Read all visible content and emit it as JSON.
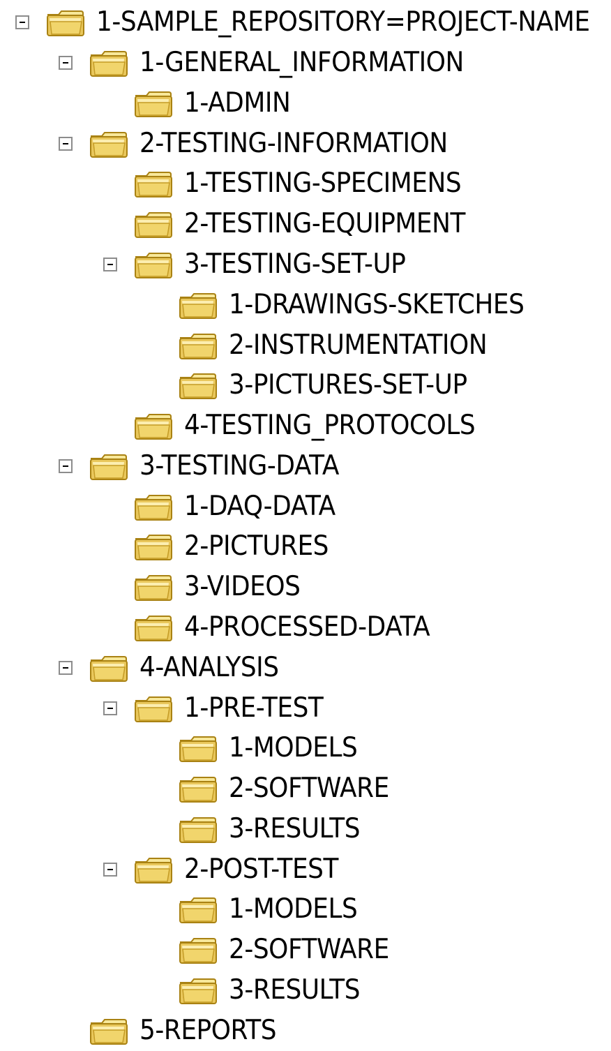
{
  "tree": {
    "root": {
      "label": "1-SAMPLE_REPOSITORY=PROJECT-NAME",
      "expanded": true,
      "icon": "folder-icon"
    },
    "items": [
      {
        "label": "1-GENERAL_INFORMATION",
        "expanded": true,
        "icon": "folder-icon"
      },
      {
        "label": "1-ADMIN",
        "icon": "folder-icon"
      },
      {
        "label": "2-TESTING-INFORMATION",
        "expanded": true,
        "icon": "folder-icon"
      },
      {
        "label": "1-TESTING-SPECIMENS",
        "icon": "folder-icon"
      },
      {
        "label": "2-TESTING-EQUIPMENT",
        "icon": "folder-icon"
      },
      {
        "label": "3-TESTING-SET-UP",
        "expanded": true,
        "icon": "folder-icon"
      },
      {
        "label": "1-DRAWINGS-SKETCHES",
        "icon": "folder-icon"
      },
      {
        "label": "2-INSTRUMENTATION",
        "icon": "folder-icon"
      },
      {
        "label": "3-PICTURES-SET-UP",
        "icon": "folder-icon"
      },
      {
        "label": "4-TESTING_PROTOCOLS",
        "icon": "folder-icon"
      },
      {
        "label": "3-TESTING-DATA",
        "expanded": true,
        "icon": "folder-icon"
      },
      {
        "label": "1-DAQ-DATA",
        "icon": "folder-icon"
      },
      {
        "label": "2-PICTURES",
        "icon": "folder-icon"
      },
      {
        "label": "3-VIDEOS",
        "icon": "folder-icon"
      },
      {
        "label": "4-PROCESSED-DATA",
        "icon": "folder-icon"
      },
      {
        "label": "4-ANALYSIS",
        "expanded": true,
        "icon": "folder-icon"
      },
      {
        "label": "1-PRE-TEST",
        "expanded": true,
        "icon": "folder-icon"
      },
      {
        "label": "1-MODELS",
        "icon": "folder-icon"
      },
      {
        "label": "2-SOFTWARE",
        "icon": "folder-icon"
      },
      {
        "label": "3-RESULTS",
        "icon": "folder-icon"
      },
      {
        "label": "2-POST-TEST",
        "expanded": true,
        "icon": "folder-icon"
      },
      {
        "label": "1-MODELS",
        "icon": "folder-icon"
      },
      {
        "label": "2-SOFTWARE",
        "icon": "folder-icon"
      },
      {
        "label": "3-RESULTS",
        "icon": "folder-icon"
      },
      {
        "label": "5-REPORTS",
        "icon": "folder-icon"
      }
    ]
  },
  "colors": {
    "folder_body": "#f3dc7a",
    "folder_light": "#fff3b0",
    "folder_outline": "#a98213",
    "toggle_border": "#8c8c8c",
    "text": "#000000"
  }
}
